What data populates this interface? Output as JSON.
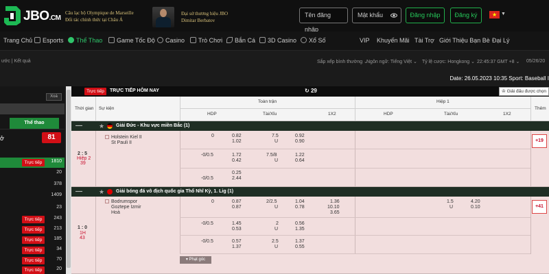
{
  "brand": {
    "logo_text": "JBO",
    "logo_suffix": ".CM",
    "club_line1": "Câu lạc bộ Olympique de Marseille",
    "club_line2": "Đối tác chính thức tại Châu Á",
    "ambassador_line1": "Đại sứ thương hiệu JBO",
    "ambassador_line2": "Dimitar Berbatov"
  },
  "auth": {
    "username_placeholder": "Tên đăng nhập",
    "password_placeholder": "Mật khẩu",
    "login_label": "Đăng nhập",
    "register_label": "Đăng ký",
    "flag_star": "★",
    "lang_caret": "▼"
  },
  "nav": {
    "items": [
      {
        "label": "Trang Chủ"
      },
      {
        "label": "Esports"
      },
      {
        "label": "Thể Thao"
      },
      {
        "label": "Game Tốc Độ"
      },
      {
        "label": "Casino"
      },
      {
        "label": "Trò Chơi"
      },
      {
        "label": "Bắn Cá"
      },
      {
        "label": "3D Casino"
      },
      {
        "label": "Xổ Số"
      },
      {
        "label": "VIP"
      },
      {
        "label": "Khuyến Mãi"
      },
      {
        "label": "Tài Trợ"
      },
      {
        "label": "Giới Thiệu Bạn Bè"
      },
      {
        "label": "Đại Lý"
      }
    ]
  },
  "filters": {
    "left": "ước | Kết quả",
    "sort": "Sắp xếp bình thường ⌄",
    "language": "Ngôn ngữ: Tiếng Việt ⌄",
    "odds": "Tỷ lệ cược: Hongkong ⌄",
    "time": "22:45:37 GMT +8 ⌄",
    "date_short": "05/26/20"
  },
  "datebar": {
    "text": "Date: 26.05.2023 10:35 Sport: Baseball I"
  },
  "sidebar": {
    "clear_label": "Xoá",
    "sport_tab": "Thể thao",
    "top_label": "ở",
    "top_count": "81",
    "rows": [
      {
        "badge": "Trực tiếp",
        "count": "1810"
      },
      {
        "badge": "",
        "count": "20"
      },
      {
        "badge": "",
        "count": "378"
      },
      {
        "badge": "",
        "count": "1409"
      },
      {
        "badge": "",
        "count": "23"
      },
      {
        "badge": "Trực tiếp",
        "count": "243"
      },
      {
        "badge": "Trực tiếp",
        "count": "213"
      },
      {
        "badge": "Trực tiếp",
        "count": "185"
      },
      {
        "badge": "Trực tiếp",
        "count": "34"
      },
      {
        "badge": "Trực tiếp",
        "count": "70"
      },
      {
        "badge": "Trực tiếp",
        "count": "20"
      }
    ]
  },
  "main": {
    "live_pill": "Trực tiếp",
    "live_title": "TRỰC TIẾP HÔM NAY",
    "refresh_icon": "↻",
    "refresh_count": "29",
    "filter_btn": "Giải đấu được chọn",
    "headers": {
      "time": "Thời gian",
      "event": "Sự kiện",
      "full": "Toàn trận",
      "half": "Hiệp 1",
      "hdp": "HDP",
      "ou": "Tài/Xỉu",
      "x12": "1X2",
      "more": "Thêm"
    },
    "leagues": [
      {
        "minus": "—",
        "star": "★",
        "name": "Giải Đức - Khu vực miền Bắc (1)",
        "match": {
          "score": "2 : 5",
          "period": "Hiệp 2",
          "minute": "39",
          "home": "Holstein Kiel II",
          "away": "St Pauli II",
          "more": "+19",
          "lines": [
            {
              "hdp": "0",
              "hdp_home": "0.82",
              "hdp_away": "1.02",
              "ou": "7.5",
              "ou_u": "U",
              "ou_over": "0.92",
              "ou_under": "0.90"
            },
            {
              "hdp": "-0/0.5",
              "hdp_home": "1.72",
              "hdp_away": "0.42",
              "ou": "7.5/8",
              "ou_u": "U",
              "ou_over": "1.22",
              "ou_under": "0.64"
            },
            {
              "hdp": "-0/0.5",
              "hdp_home": "0.25",
              "hdp_away": "2.44"
            }
          ]
        }
      },
      {
        "minus": "—",
        "star": "★",
        "name": "Giải bóng đá vô địch quốc gia Thổ Nhĩ Kỳ, 1. Lig (1)",
        "match": {
          "score": "1 : 0",
          "period": "1H",
          "minute": "43",
          "home": "Bodrumspor",
          "away": "Goztepe Izmir",
          "draw": "Hoà",
          "more": "+41",
          "x12": [
            "1.36",
            "10.10",
            "3.65"
          ],
          "half_line": {
            "ou": "1.5",
            "ou_u": "U",
            "ou_over": "4.20",
            "ou_under": "0.10"
          },
          "lines": [
            {
              "hdp": "0",
              "hdp_home": "0.87",
              "hdp_away": "0.87",
              "ou": "2/2.5",
              "ou_u": "U",
              "ou_over": "1.04",
              "ou_under": "0.78"
            },
            {
              "hdp": "-0/0.5",
              "hdp_home": "1.45",
              "hdp_away": "0.53",
              "ou": "2",
              "ou_u": "U",
              "ou_over": "0.56",
              "ou_under": "1.35"
            },
            {
              "hdp": "-0/0.5",
              "hdp_home": "0.57",
              "hdp_away": "1.37",
              "ou": "2.5",
              "ou_u": "U",
              "ou_over": "1.37",
              "ou_under": "0.55"
            }
          ],
          "corner_label": "▾ Phạt góc"
        }
      }
    ]
  },
  "colors": {
    "accent_green": "#1f8a3a",
    "live_red": "#d20f16",
    "row_pink": "#f2dede",
    "league_dark": "#1f2e24"
  }
}
